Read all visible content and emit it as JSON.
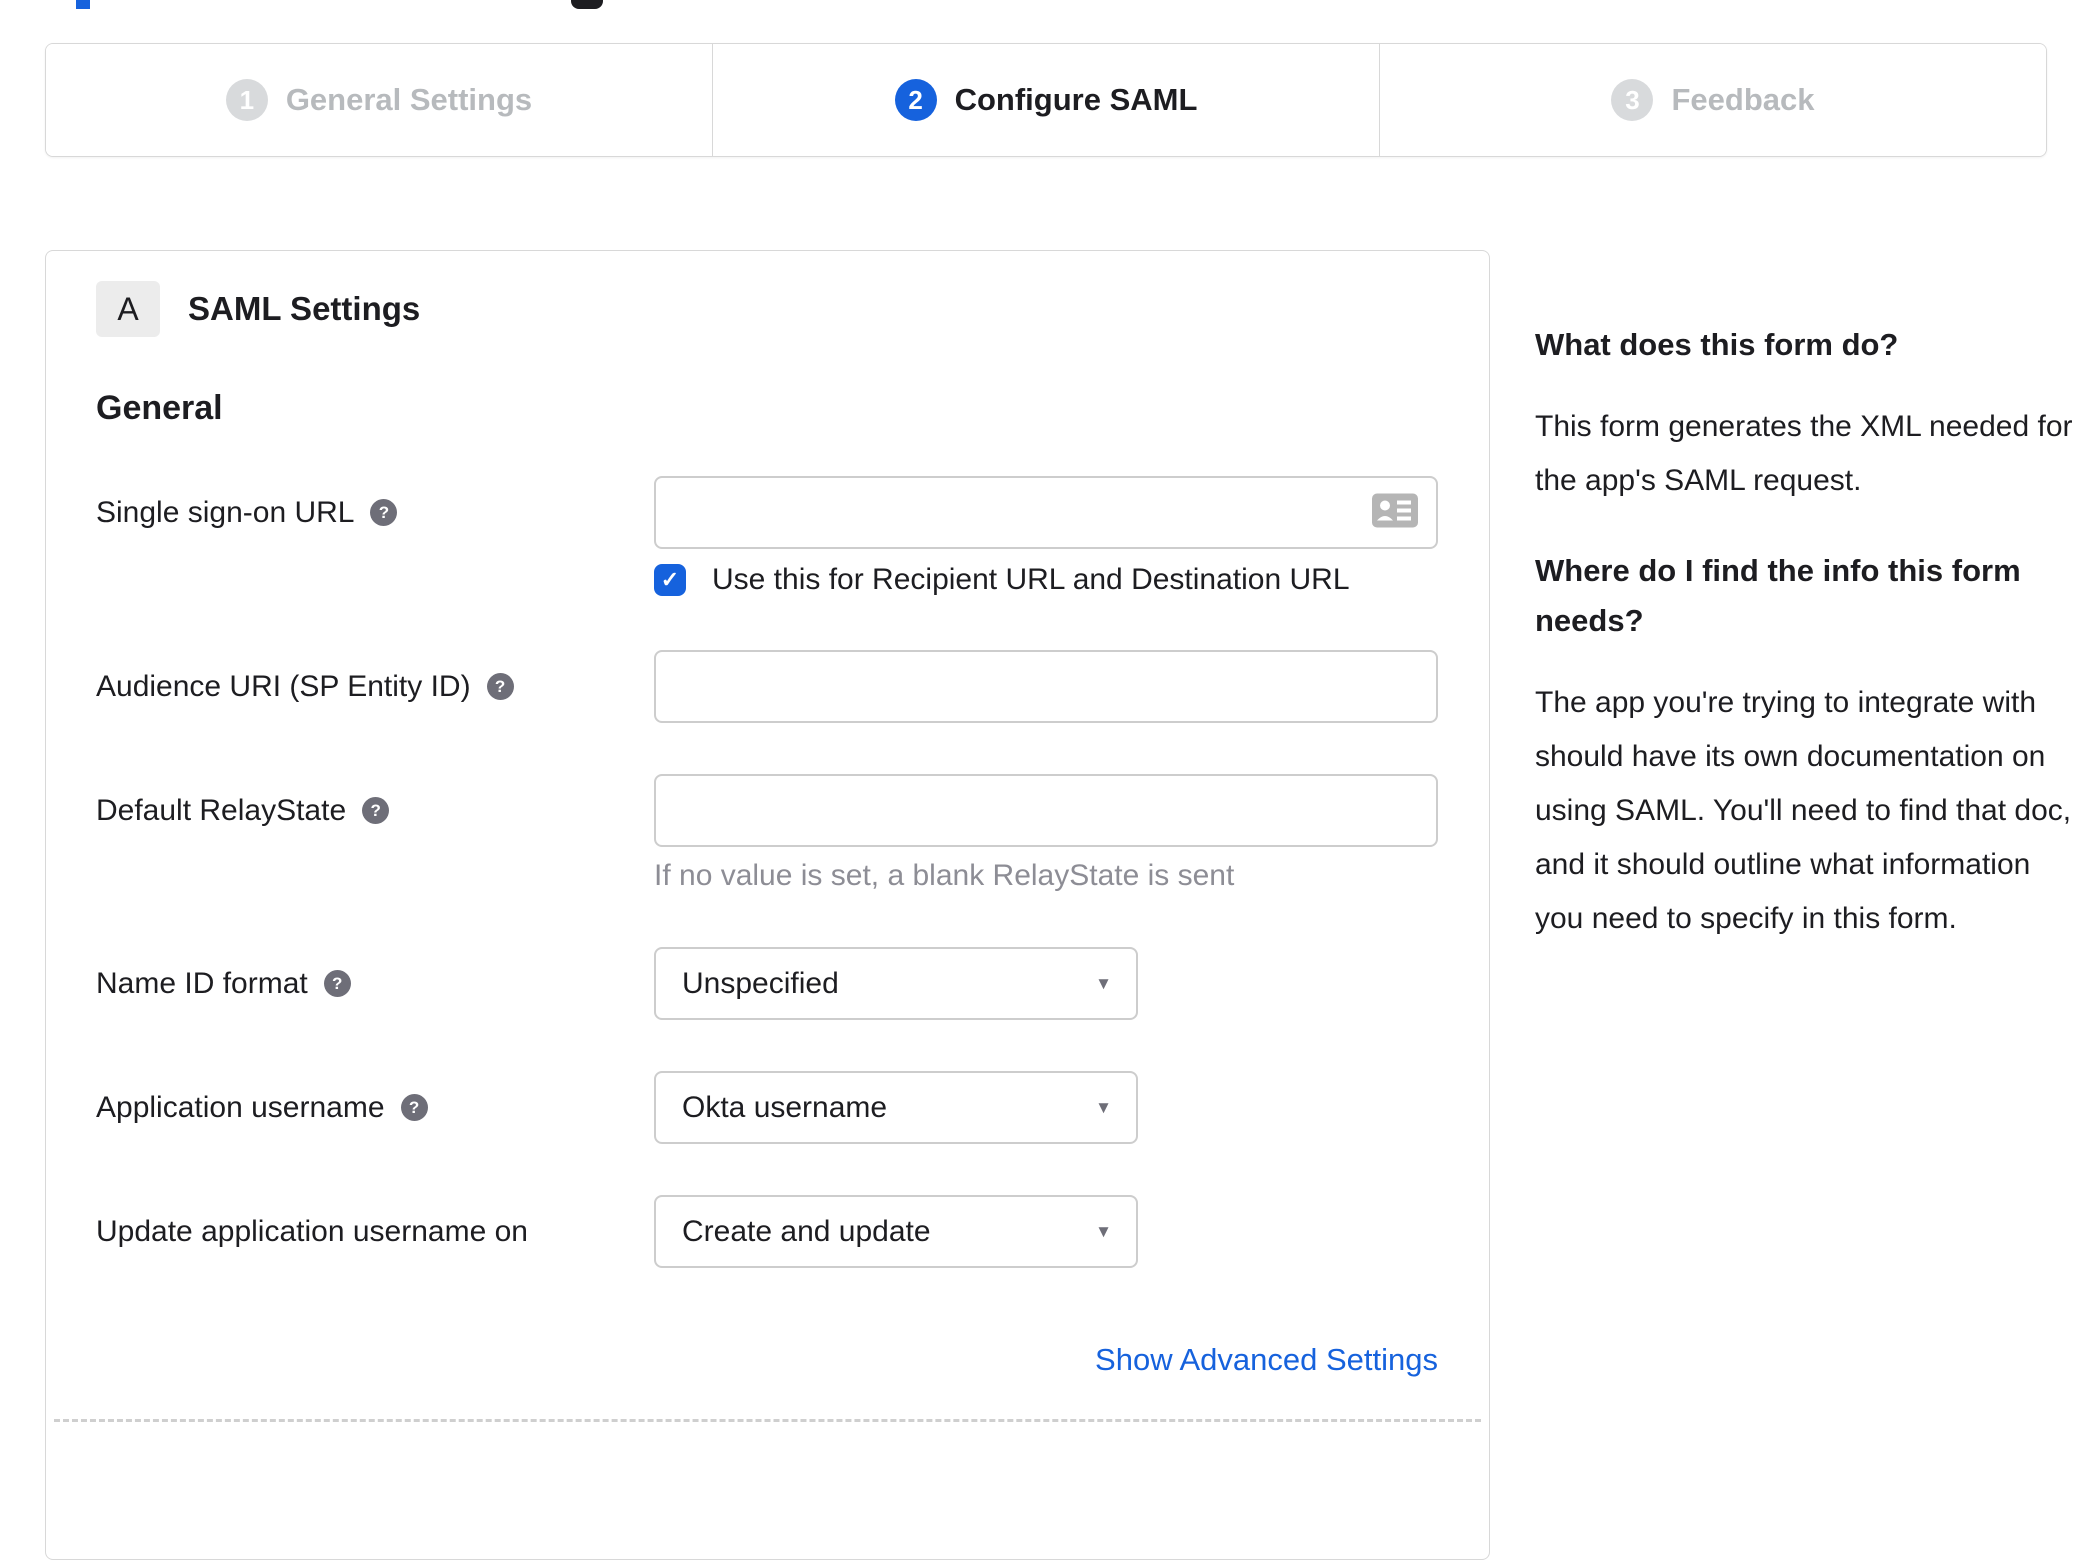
{
  "stepper": {
    "steps": [
      {
        "number": "1",
        "label": "General Settings",
        "active": false
      },
      {
        "number": "2",
        "label": "Configure SAML",
        "active": true
      },
      {
        "number": "3",
        "label": "Feedback",
        "active": false
      }
    ]
  },
  "saml_panel": {
    "badge": "A",
    "title": "SAML Settings",
    "section": "General",
    "fields": [
      {
        "label": "Single sign-on URL",
        "value": "",
        "checkbox_label": "Use this for Recipient URL and Destination URL",
        "checkbox_checked": true
      },
      {
        "label": "Audience URI (SP Entity ID)",
        "value": ""
      },
      {
        "label": "Default RelayState",
        "value": "",
        "hint": "If no value is set, a blank RelayState is sent"
      },
      {
        "label": "Name ID format",
        "value": "Unspecified"
      },
      {
        "label": "Application username",
        "value": "Okta username"
      },
      {
        "label": "Update application username on",
        "value": "Create and update"
      }
    ],
    "advanced_link": "Show Advanced Settings"
  },
  "help_panel": {
    "sections": [
      {
        "heading": "What does this form do?",
        "body": "This form generates the XML needed for the app's SAML request."
      },
      {
        "heading": "Where do I find the info this form needs?",
        "body": "The app you're trying to integrate with should have its own documentation on using SAML. You'll need to find that doc, and it should outline what information you need to specify in this form."
      }
    ]
  },
  "icons": {
    "help": "?",
    "check": "✓",
    "dropdown": "▼"
  },
  "colors": {
    "accent_blue": "#1662dd",
    "link_blue": "#1662dd",
    "text_dark": "#1d1d21",
    "inactive_gray": "#b7babd",
    "circle_gray": "#d8dadc",
    "border_gray": "#d8d8d8",
    "hint_gray": "#8d8d95",
    "help_icon_gray": "#6e6e78",
    "icon_gray": "#b5b5b5"
  }
}
